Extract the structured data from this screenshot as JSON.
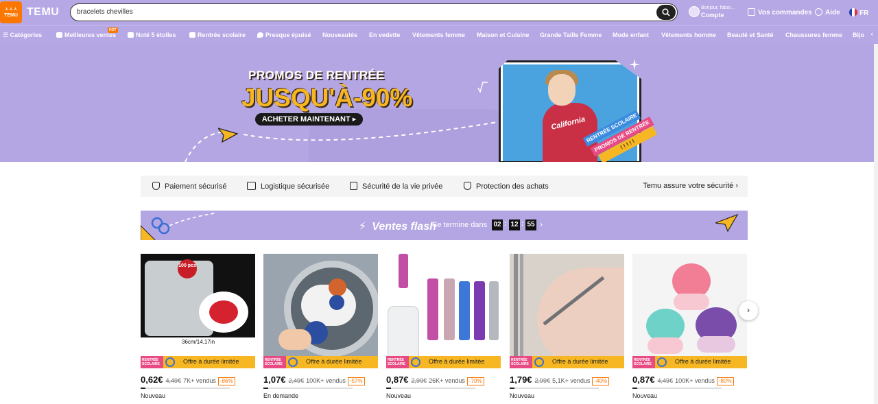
{
  "header": {
    "logo_text": "TEMU",
    "logo_badge": "ㅅㅅㅅ TEMU",
    "search_value": "bracelets chevilles",
    "account_greeting": "Bonjour, fabor...",
    "account_label": "Compte",
    "orders": "Vos commandes",
    "help": "Aide",
    "lang": "FR"
  },
  "nav": {
    "hot_badge": "HOT",
    "items": [
      "Catégories",
      "Meilleures ventes",
      "Noté 5 étoiles",
      "Rentrée scolaire",
      "Presque épuisé",
      "Nouveautés",
      "En vedette",
      "Vêtements femme",
      "Maison et Cuisine",
      "Grande Taille Femme",
      "Mode enfant",
      "Vêtements homme",
      "Beauté et Santé",
      "Chaussures femme",
      "Bijo"
    ]
  },
  "banner": {
    "line1": "PROMOS DE RENTRÉE",
    "line2": "JUSQU'À-90%",
    "button": "ACHETER MAINTENANT ▸",
    "shirt_text": "California",
    "ribbon1": "RENTRÉE SCOLAIRE",
    "ribbon2": "PROMOS DE RENTRÉE",
    "ribbon3": "! ! ! ! !"
  },
  "trust": {
    "items": [
      "Paiement sécurisé",
      "Logistique sécurisée",
      "Sécurité de la vie privée",
      "Protection des achats"
    ],
    "right": "Temu assure votre sécurité"
  },
  "flash": {
    "title": "Ventes flash",
    "ends_in": "Se termine dans",
    "hours": "02",
    "minutes": "12",
    "seconds": "55"
  },
  "offer": {
    "badge": "RENTRÉE SCOLAIRE",
    "label": "Offre à durée limitée"
  },
  "products": [
    {
      "price": "0,62€",
      "old": "4,49€",
      "sold": "7K+ vendus",
      "discount": "-86%",
      "status": "Nouveau"
    },
    {
      "price": "1,07€",
      "old": "2,49€",
      "sold": "100K+ vendus",
      "discount": "-57%",
      "status": "En demande"
    },
    {
      "price": "0,87€",
      "old": "2,99€",
      "sold": "26K+ vendus",
      "discount": "-70%",
      "status": "Nouveau"
    },
    {
      "price": "1,79€",
      "old": "2,99€",
      "sold": "5,1K+ vendus",
      "discount": "-40%",
      "status": "Nouveau"
    },
    {
      "price": "0,87€",
      "old": "4,49€",
      "sold": "100K+ vendus",
      "discount": "-80%",
      "status": "Nouveau"
    }
  ],
  "product_images": {
    "p1_badge": "100 pcs",
    "p1_measure": "36cm/14.17in"
  }
}
